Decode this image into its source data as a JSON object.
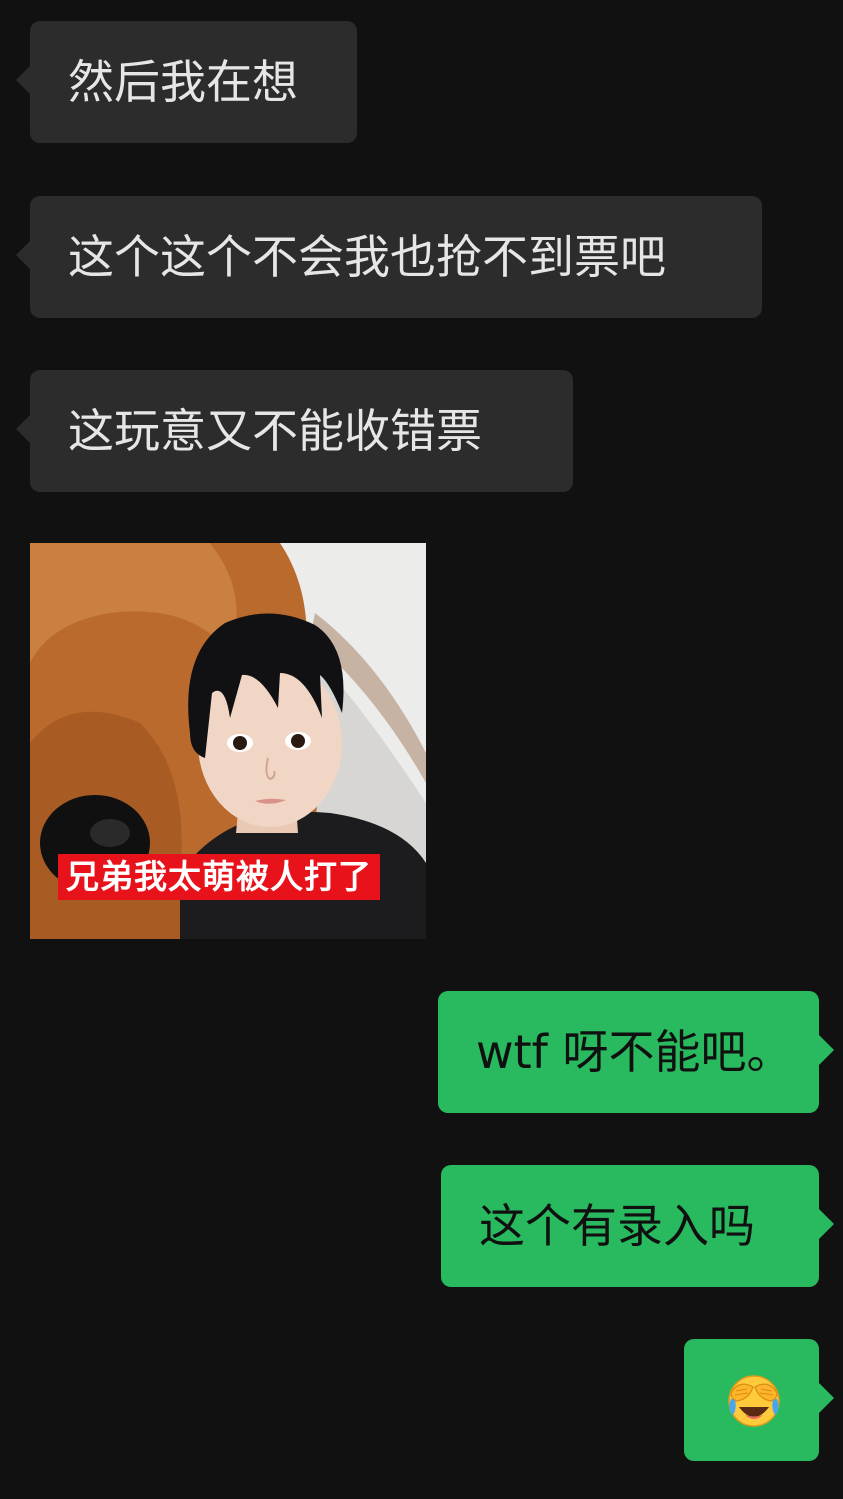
{
  "messages": [
    {
      "direction": "received",
      "type": "text",
      "text": "然后我在想"
    },
    {
      "direction": "received",
      "type": "text",
      "text": "这个这个不会我也抢不到票吧"
    },
    {
      "direction": "received",
      "type": "text",
      "text": "这玩意又不能收错票"
    },
    {
      "direction": "received",
      "type": "image",
      "caption": "兄弟我太萌被人打了"
    },
    {
      "direction": "sent",
      "type": "text",
      "text": "wtf 呀不能吧。"
    },
    {
      "direction": "sent",
      "type": "text",
      "text": "这个有录入吗"
    },
    {
      "direction": "sent",
      "type": "emoji",
      "icon": "face-palm-laughing-emoji"
    }
  ],
  "colors": {
    "background": "#111111",
    "received_bubble": "#2c2c2c",
    "sent_bubble": "#29b95f",
    "caption_bg": "#e8121b"
  }
}
